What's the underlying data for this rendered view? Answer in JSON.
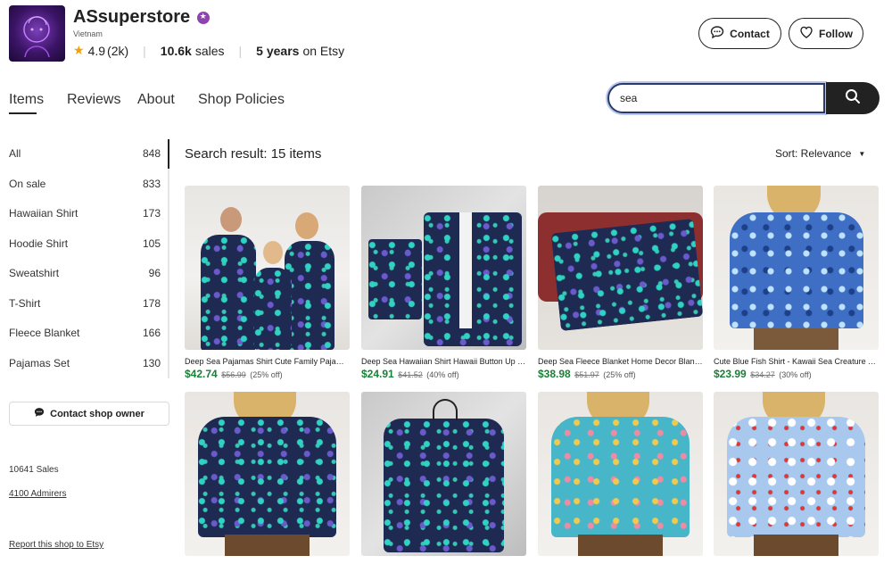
{
  "shop": {
    "name": "ASsuperstore",
    "location": "Vietnam",
    "rating": "4.9",
    "reviews_count": "(2k)",
    "sales_value": "10.6k",
    "sales_label": "sales",
    "years_value": "5 years",
    "years_label": "on Etsy"
  },
  "header": {
    "contact_label": "Contact",
    "follow_label": "Follow"
  },
  "tabs": [
    {
      "label": "Items"
    },
    {
      "label": "Reviews"
    },
    {
      "label": "About"
    },
    {
      "label": "Shop Policies"
    }
  ],
  "search": {
    "value": "sea",
    "placeholder": ""
  },
  "sidebar": {
    "items": [
      {
        "label": "All",
        "count": "848"
      },
      {
        "label": "On sale",
        "count": "833"
      },
      {
        "label": "Hawaiian Shirt",
        "count": "173"
      },
      {
        "label": "Hoodie Shirt",
        "count": "105"
      },
      {
        "label": "Sweatshirt",
        "count": "96"
      },
      {
        "label": "T-Shirt",
        "count": "178"
      },
      {
        "label": "Fleece Blanket",
        "count": "166"
      },
      {
        "label": "Pajamas Set",
        "count": "130"
      }
    ],
    "contact_owner_label": "Contact shop owner",
    "sales_text": "10641 Sales",
    "admirers_text": "4100 Admirers",
    "report_text": "Report this shop to Etsy"
  },
  "results": {
    "title": "Search result: 15 items",
    "sort_label": "Sort: Relevance"
  },
  "products": [
    {
      "title": "Deep Sea Pajamas Shirt Cute Family Pajamas Set",
      "price": "$42.74",
      "old_price": "$56.99",
      "discount": "(25% off)"
    },
    {
      "title": "Deep Sea Hawaiian Shirt Hawaii Button Up Shirt",
      "price": "$24.91",
      "old_price": "$41.52",
      "discount": "(40% off)"
    },
    {
      "title": "Deep Sea Fleece Blanket Home Decor Blanket",
      "price": "$38.98",
      "old_price": "$51.97",
      "discount": "(25% off)"
    },
    {
      "title": "Cute Blue Fish Shirt - Kawaii Sea Creature Tee",
      "price": "$23.99",
      "old_price": "$34.27",
      "discount": "(30% off)"
    },
    {
      "title": "",
      "price": "",
      "old_price": "",
      "discount": ""
    },
    {
      "title": "",
      "price": "",
      "old_price": "",
      "discount": ""
    },
    {
      "title": "",
      "price": "",
      "old_price": "",
      "discount": ""
    },
    {
      "title": "",
      "price": "",
      "old_price": "",
      "discount": ""
    }
  ],
  "colors": {
    "accent_dark": "#222222",
    "sale_green": "#1a7f37",
    "star_yellow": "#f1a10a",
    "star_seller_purple": "#8e44ad",
    "search_focus": "#2a3a6a"
  }
}
